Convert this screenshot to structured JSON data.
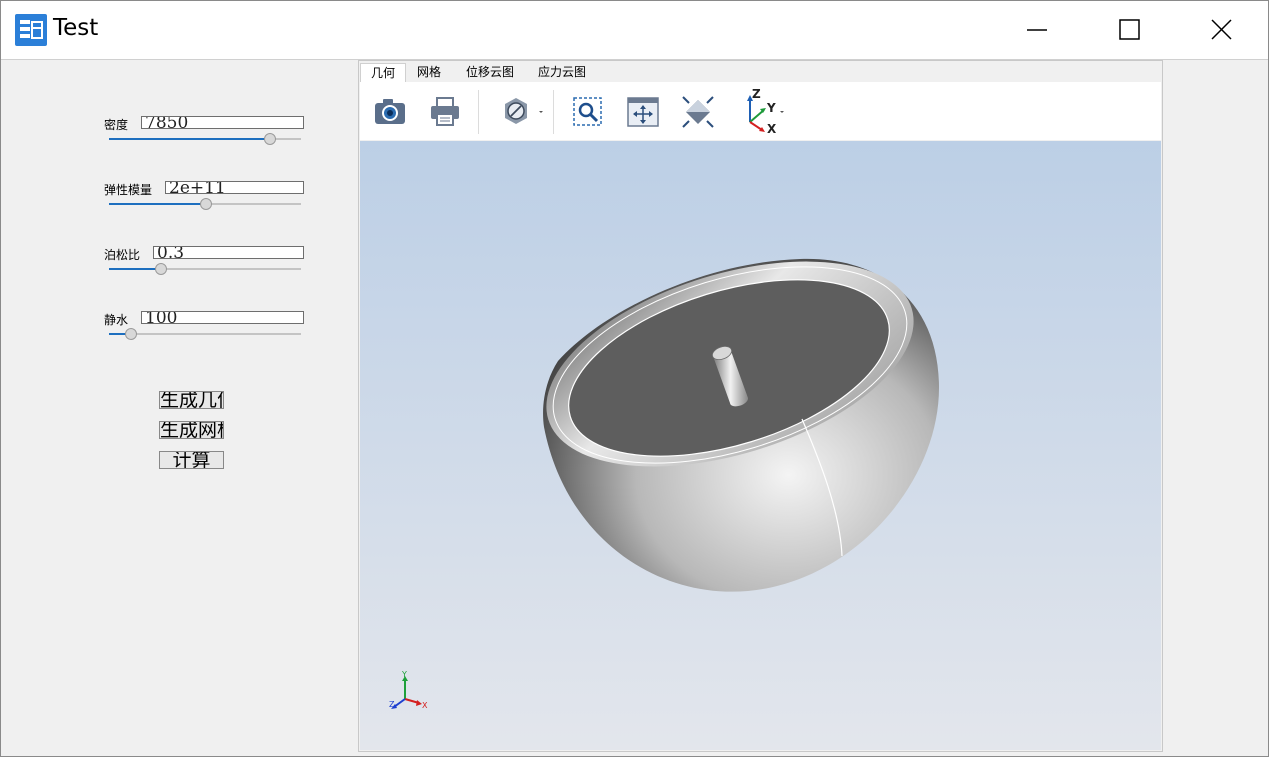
{
  "window": {
    "title": "Test"
  },
  "params": [
    {
      "label": "密度",
      "value": "7850",
      "level": 0.85
    },
    {
      "label": "弹性模量",
      "value": "2e+11",
      "level": 0.5
    },
    {
      "label": "泊松比",
      "value": "0.3",
      "level": 0.25
    },
    {
      "label": "静水",
      "value": "100",
      "level": 0.09
    }
  ],
  "buttons": {
    "generate_geometry": "生成几何",
    "generate_mesh": "生成网格",
    "compute": "计算"
  },
  "tabs": [
    "几何",
    "网格",
    "位移云图",
    "应力云图"
  ],
  "active_tab": "几何",
  "toolbar": {
    "icons": [
      "camera-icon",
      "printer-icon",
      "section-view-icon",
      "zoom-window-icon",
      "pan-fit-icon",
      "fit-all-icon",
      "view-orientation-icon"
    ]
  },
  "triad": {
    "x": "X",
    "y": "Y",
    "z": "Z"
  },
  "colors": {
    "accent": "#1e6fbf",
    "viewport_top": "#bccfe6",
    "viewport_bottom": "#e3e6ec"
  }
}
